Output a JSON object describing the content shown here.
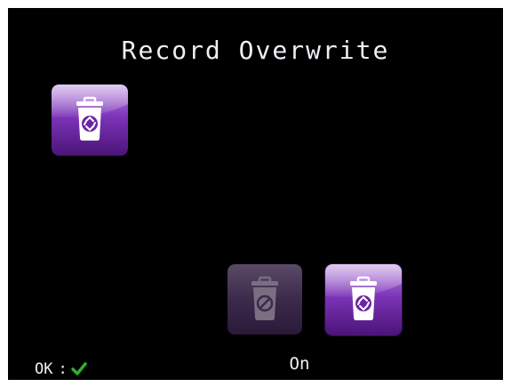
{
  "screen": {
    "title": "Record Overwrite"
  },
  "current_setting": {
    "icon": "trash-recycle-icon",
    "accent_color": "#7b2fb0"
  },
  "options": [
    {
      "id": "off",
      "icon": "trash-disabled-icon",
      "selected": false
    },
    {
      "id": "on",
      "icon": "trash-recycle-icon",
      "selected": true
    }
  ],
  "selected_option_label": "On",
  "footer": {
    "ok_label": "OK",
    "separator": ":",
    "confirm_icon": "checkmark-icon",
    "confirm_color": "#2fae2f"
  }
}
